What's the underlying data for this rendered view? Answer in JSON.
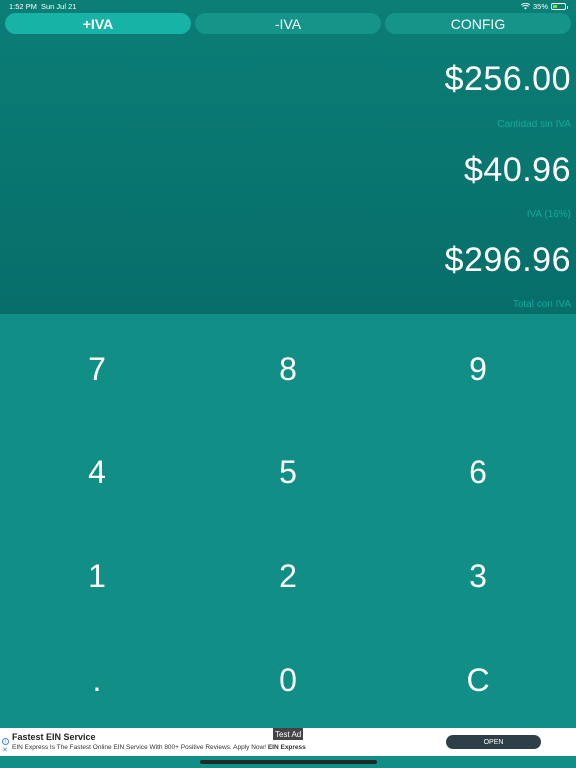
{
  "status_bar": {
    "time": "1:52 PM",
    "date": "Sun Jul 21",
    "battery": "35%",
    "battery_level": 0.35
  },
  "tabs": [
    {
      "label": "+IVA",
      "selected": true
    },
    {
      "label": "-IVA",
      "selected": false
    },
    {
      "label": "CONFIG",
      "selected": false
    }
  ],
  "results": {
    "amount_without_iva": "$256.00",
    "amount_without_iva_label": "Cantidad sin IVA",
    "iva_amount": "$40.96",
    "iva_label": "IVA (16%)",
    "total": "$296.96",
    "total_label": "Total con IVA"
  },
  "keypad": {
    "k7": "7",
    "k8": "8",
    "k9": "9",
    "k4": "4",
    "k5": "5",
    "k6": "6",
    "k1": "1",
    "k2": "2",
    "k3": "3",
    "kdot": ".",
    "k0": "0",
    "kclear": "C"
  },
  "ad": {
    "badge": "Test Ad",
    "title": "Fastest EIN Service",
    "description": "EIN Express Is The Fastest Online EIN Service With 800+ Positive Reviews. Apply Now!",
    "advertiser": "EIN Express",
    "cta": "OPEN"
  },
  "colors": {
    "top_panel": "#076e6a",
    "keypad_bg": "#118f86",
    "tab_selected": "#16b3a6",
    "tab_default": "#159589",
    "caption": "#12a99e"
  }
}
